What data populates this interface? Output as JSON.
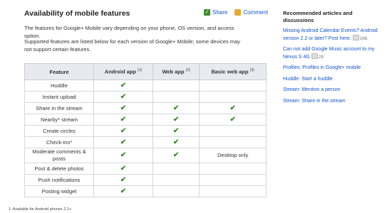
{
  "page": {
    "title": "Availability of mobile features",
    "share_label": "Share",
    "comment_label": "Comment",
    "share_icon": "share-icon",
    "comment_icon": "comment-icon",
    "intro": "The features for Google+ Mobile vary depending on your phone, OS version, and access option.",
    "intro2": "Supported features are listed below for each version of Google+ Mobile; some devices may not support certain features.",
    "footnote": "1.  Available for Android phones 2.1+"
  },
  "table": {
    "headers": [
      "Feature",
      "Android app",
      "Web app",
      "Basic web app"
    ],
    "header_sups": [
      "",
      "(1)",
      "(2)",
      "(3)"
    ],
    "rows": [
      {
        "feature": "Huddle",
        "android": "✔",
        "web": "",
        "basic": ""
      },
      {
        "feature": "Instant upload",
        "android": "✔",
        "web": "",
        "basic": ""
      },
      {
        "feature": "Share in the stream",
        "android": "✔",
        "web": "✔",
        "basic": "✔"
      },
      {
        "feature": "Nearby* stream",
        "android": "✔",
        "web": "✔",
        "basic": "✔"
      },
      {
        "feature": "Create circles",
        "android": "✔",
        "web": "✔",
        "basic": ""
      },
      {
        "feature": "Check-ins*",
        "android": "✔",
        "web": "✔",
        "basic": ""
      },
      {
        "feature": "Moderate comments & posts",
        "android": "✔",
        "web": "✔",
        "basic": "Desktop only"
      },
      {
        "feature": "Post & delete photos",
        "android": "✔",
        "web": "",
        "basic": ""
      },
      {
        "feature": "Push notifications",
        "android": "✔",
        "web": "",
        "basic": ""
      },
      {
        "feature": "Posting widget",
        "android": "✔",
        "web": "",
        "basic": ""
      }
    ]
  },
  "sidebar": {
    "title": "Recommended articles and discussions",
    "items": [
      {
        "text": "Missing Android Calendar Events? Android version 2.2 or later? Post here.",
        "count": "166"
      },
      {
        "text": "Can not add Google Music account to my Nexus S 4G",
        "count": "28"
      },
      {
        "text": "Profiles: Profiles in Google+ mobile",
        "count": ""
      },
      {
        "text": "Huddle: Start a huddle",
        "count": ""
      },
      {
        "text": "Stream: Mention a person",
        "count": ""
      },
      {
        "text": "Stream: Share in the stream",
        "count": ""
      }
    ]
  },
  "colors": {
    "link": "#1155cc",
    "check": "#3d8c2f",
    "header_bg": "#e8eaf0"
  }
}
